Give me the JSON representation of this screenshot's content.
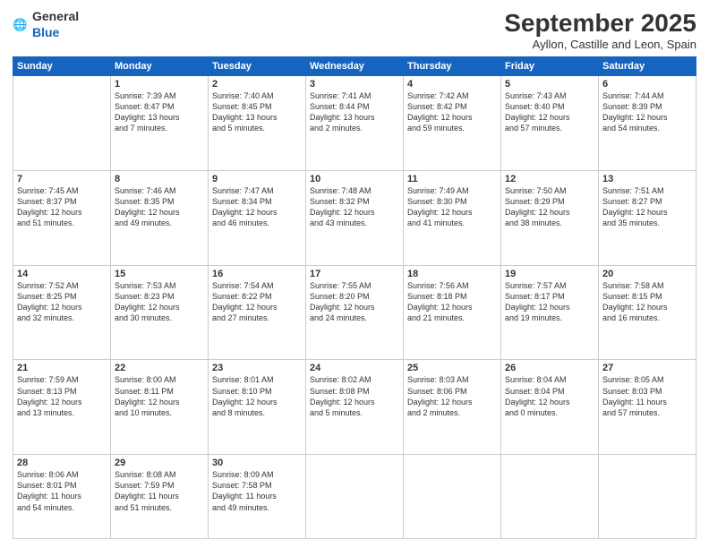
{
  "logo": {
    "general": "General",
    "blue": "Blue"
  },
  "title": "September 2025",
  "subtitle": "Ayllon, Castille and Leon, Spain",
  "weekdays": [
    "Sunday",
    "Monday",
    "Tuesday",
    "Wednesday",
    "Thursday",
    "Friday",
    "Saturday"
  ],
  "weeks": [
    [
      {
        "day": "",
        "info": ""
      },
      {
        "day": "1",
        "info": "Sunrise: 7:39 AM\nSunset: 8:47 PM\nDaylight: 13 hours\nand 7 minutes."
      },
      {
        "day": "2",
        "info": "Sunrise: 7:40 AM\nSunset: 8:45 PM\nDaylight: 13 hours\nand 5 minutes."
      },
      {
        "day": "3",
        "info": "Sunrise: 7:41 AM\nSunset: 8:44 PM\nDaylight: 13 hours\nand 2 minutes."
      },
      {
        "day": "4",
        "info": "Sunrise: 7:42 AM\nSunset: 8:42 PM\nDaylight: 12 hours\nand 59 minutes."
      },
      {
        "day": "5",
        "info": "Sunrise: 7:43 AM\nSunset: 8:40 PM\nDaylight: 12 hours\nand 57 minutes."
      },
      {
        "day": "6",
        "info": "Sunrise: 7:44 AM\nSunset: 8:39 PM\nDaylight: 12 hours\nand 54 minutes."
      }
    ],
    [
      {
        "day": "7",
        "info": "Sunrise: 7:45 AM\nSunset: 8:37 PM\nDaylight: 12 hours\nand 51 minutes."
      },
      {
        "day": "8",
        "info": "Sunrise: 7:46 AM\nSunset: 8:35 PM\nDaylight: 12 hours\nand 49 minutes."
      },
      {
        "day": "9",
        "info": "Sunrise: 7:47 AM\nSunset: 8:34 PM\nDaylight: 12 hours\nand 46 minutes."
      },
      {
        "day": "10",
        "info": "Sunrise: 7:48 AM\nSunset: 8:32 PM\nDaylight: 12 hours\nand 43 minutes."
      },
      {
        "day": "11",
        "info": "Sunrise: 7:49 AM\nSunset: 8:30 PM\nDaylight: 12 hours\nand 41 minutes."
      },
      {
        "day": "12",
        "info": "Sunrise: 7:50 AM\nSunset: 8:29 PM\nDaylight: 12 hours\nand 38 minutes."
      },
      {
        "day": "13",
        "info": "Sunrise: 7:51 AM\nSunset: 8:27 PM\nDaylight: 12 hours\nand 35 minutes."
      }
    ],
    [
      {
        "day": "14",
        "info": "Sunrise: 7:52 AM\nSunset: 8:25 PM\nDaylight: 12 hours\nand 32 minutes."
      },
      {
        "day": "15",
        "info": "Sunrise: 7:53 AM\nSunset: 8:23 PM\nDaylight: 12 hours\nand 30 minutes."
      },
      {
        "day": "16",
        "info": "Sunrise: 7:54 AM\nSunset: 8:22 PM\nDaylight: 12 hours\nand 27 minutes."
      },
      {
        "day": "17",
        "info": "Sunrise: 7:55 AM\nSunset: 8:20 PM\nDaylight: 12 hours\nand 24 minutes."
      },
      {
        "day": "18",
        "info": "Sunrise: 7:56 AM\nSunset: 8:18 PM\nDaylight: 12 hours\nand 21 minutes."
      },
      {
        "day": "19",
        "info": "Sunrise: 7:57 AM\nSunset: 8:17 PM\nDaylight: 12 hours\nand 19 minutes."
      },
      {
        "day": "20",
        "info": "Sunrise: 7:58 AM\nSunset: 8:15 PM\nDaylight: 12 hours\nand 16 minutes."
      }
    ],
    [
      {
        "day": "21",
        "info": "Sunrise: 7:59 AM\nSunset: 8:13 PM\nDaylight: 12 hours\nand 13 minutes."
      },
      {
        "day": "22",
        "info": "Sunrise: 8:00 AM\nSunset: 8:11 PM\nDaylight: 12 hours\nand 10 minutes."
      },
      {
        "day": "23",
        "info": "Sunrise: 8:01 AM\nSunset: 8:10 PM\nDaylight: 12 hours\nand 8 minutes."
      },
      {
        "day": "24",
        "info": "Sunrise: 8:02 AM\nSunset: 8:08 PM\nDaylight: 12 hours\nand 5 minutes."
      },
      {
        "day": "25",
        "info": "Sunrise: 8:03 AM\nSunset: 8:06 PM\nDaylight: 12 hours\nand 2 minutes."
      },
      {
        "day": "26",
        "info": "Sunrise: 8:04 AM\nSunset: 8:04 PM\nDaylight: 12 hours\nand 0 minutes."
      },
      {
        "day": "27",
        "info": "Sunrise: 8:05 AM\nSunset: 8:03 PM\nDaylight: 11 hours\nand 57 minutes."
      }
    ],
    [
      {
        "day": "28",
        "info": "Sunrise: 8:06 AM\nSunset: 8:01 PM\nDaylight: 11 hours\nand 54 minutes."
      },
      {
        "day": "29",
        "info": "Sunrise: 8:08 AM\nSunset: 7:59 PM\nDaylight: 11 hours\nand 51 minutes."
      },
      {
        "day": "30",
        "info": "Sunrise: 8:09 AM\nSunset: 7:58 PM\nDaylight: 11 hours\nand 49 minutes."
      },
      {
        "day": "",
        "info": ""
      },
      {
        "day": "",
        "info": ""
      },
      {
        "day": "",
        "info": ""
      },
      {
        "day": "",
        "info": ""
      }
    ]
  ]
}
